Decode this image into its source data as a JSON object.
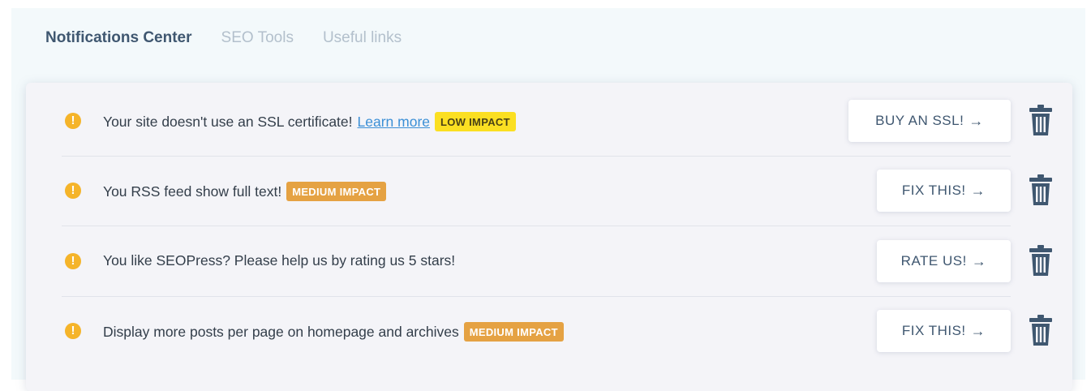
{
  "tabs": [
    {
      "label": "Notifications Center",
      "active": true
    },
    {
      "label": "SEO Tools",
      "active": false
    },
    {
      "label": "Useful links",
      "active": false
    }
  ],
  "notifications": [
    {
      "icon": "warning-icon",
      "icon_glyph": "!",
      "message": "Your site doesn't use an SSL certificate!",
      "link_text": "Learn more",
      "badge": "LOW IMPACT",
      "action_label": "BUY AN SSL!",
      "arrow": "→"
    },
    {
      "icon": "warning-icon",
      "icon_glyph": "!",
      "message": "You RSS feed show full text!",
      "badge": "MEDIUM IMPACT",
      "action_label": "FIX THIS!",
      "arrow": "→"
    },
    {
      "icon": "warning-icon",
      "icon_glyph": "!",
      "message": "You like SEOPress? Please help us by rating us 5 stars!",
      "action_label": "RATE US!",
      "arrow": "→"
    },
    {
      "icon": "warning-icon",
      "icon_glyph": "!",
      "message": "Display more posts per page on homepage and archives",
      "badge": "MEDIUM IMPACT",
      "action_label": "FIX THIS!",
      "arrow": "→"
    }
  ],
  "colors": {
    "warning": "#f5b42a",
    "low_impact": "#fbdf22",
    "medium_impact": "#e5a243",
    "link": "#3b8fd6",
    "trash": "#3f5770"
  }
}
